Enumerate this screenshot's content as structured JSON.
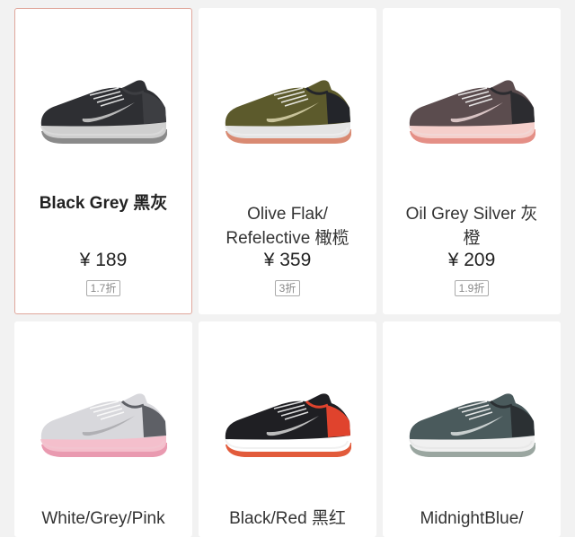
{
  "products": [
    {
      "name": "Black Grey 黑灰",
      "price": "¥ 189",
      "discount": "1.7折",
      "selected": true,
      "colors": {
        "upper": "#2e2f33",
        "accent": "#3d3e42",
        "sole": "#d9d9d9",
        "midsole": "#cfcfcf",
        "outsole": "#8a8a8a",
        "swoosh": "#b9b9b9"
      }
    },
    {
      "name": "Olive Flak/ Refelective 橄榄",
      "price": "¥ 359",
      "discount": "3折",
      "selected": false,
      "colors": {
        "upper": "#5c5a2c",
        "accent": "#23252a",
        "sole": "#ececec",
        "midsole": "#e4e4e4",
        "outsole": "#d98a72",
        "swoosh": "#c8c39a"
      }
    },
    {
      "name": "Oil Grey Silver 灰橙",
      "price": "¥ 209",
      "discount": "1.9折",
      "selected": false,
      "colors": {
        "upper": "#5b4c4e",
        "accent": "#2c2c30",
        "sole": "#f1d7d5",
        "midsole": "#f5cfcb",
        "outsole": "#e48f86",
        "swoosh": "#d8c3c3"
      }
    },
    {
      "name": "White/Grey/Pink",
      "price": "",
      "discount": "",
      "selected": false,
      "colors": {
        "upper": "#d8d8dc",
        "accent": "#5e6066",
        "sole": "#f2c4cf",
        "midsole": "#f4bfcc",
        "outsole": "#e99ab0",
        "swoosh": "#b0b0b4"
      }
    },
    {
      "name": "Black/Red 黑红",
      "price": "",
      "discount": "",
      "selected": false,
      "colors": {
        "upper": "#1f1f23",
        "accent": "#e0432d",
        "sole": "#f1f1f1",
        "midsole": "#ffffff",
        "outsole": "#e25b3b",
        "swoosh": "#bdbdbd"
      }
    },
    {
      "name": "MidnightBlue/",
      "price": "",
      "discount": "",
      "selected": false,
      "colors": {
        "upper": "#4a5a5c",
        "accent": "#2b3033",
        "sole": "#e8e8e8",
        "midsole": "#f0f0f0",
        "outsole": "#9aa6a0",
        "swoosh": "#c9cfcf"
      }
    }
  ]
}
